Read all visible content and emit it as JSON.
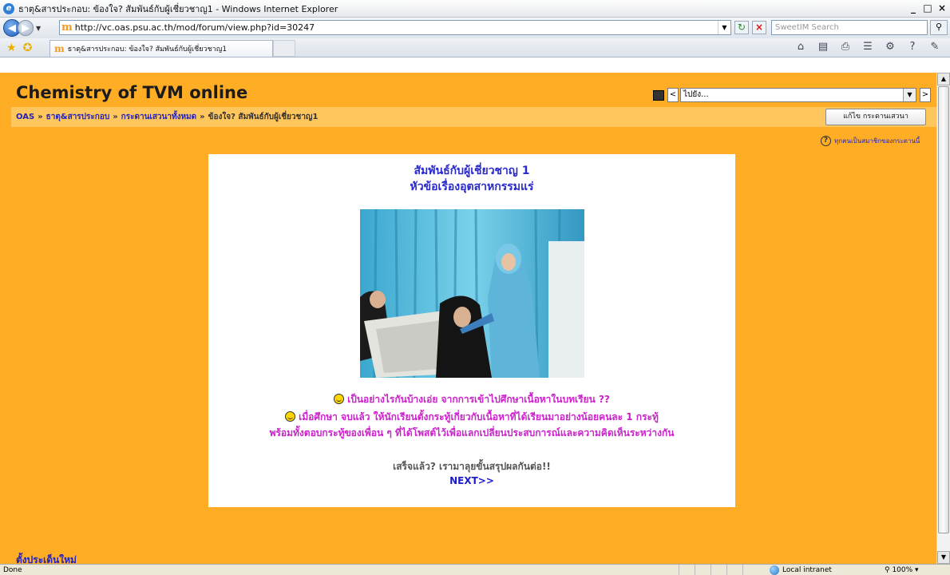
{
  "window": {
    "title": "ธาตุ&สารประกอบ: ข้องใจ? สัมพันธ์กับผู้เชี่ยวชาญ1 - Windows Internet Explorer",
    "buttons": [
      "_",
      "□",
      "×"
    ]
  },
  "address": {
    "url": "http://vc.oas.psu.ac.th/mod/forum/view.php?id=30247",
    "search_placeholder": "SweetIM Search"
  },
  "tab": {
    "label": "ธาตุ&สารประกอบ: ข้องใจ? สัมพันธ์กับผู้เชี่ยวชาญ1"
  },
  "page": {
    "site_title": "Chemistry of TVM online",
    "jump_to": "ไปยัง...",
    "breadcrumb": [
      "OAS",
      "ธาตุ&สารประกอบ",
      "กระดานเสวนาทั้งหมด"
    ],
    "breadcrumb_current": "ข้องใจ? สัมพันธ์กับผู้เชี่ยวชาญ1",
    "breadcrumb_sep": "»",
    "edit_button": "แก้ไข กระดานเสวนา",
    "subscribe_text": "ทุกคนเป็นสมาชิกของกระดานนี้",
    "new_topic": "ตั้งประเด็นใหม่"
  },
  "post": {
    "title_line1": "สัมพันธ์กับผู้เชี่ยวชาญ 1",
    "title_line2": "หัวข้อเรื่องอุตสาหกรรมแร่",
    "line1": "เป็นอย่างไรกันบ้างเอ่ย จากการเข้าไปศึกษาเนื้อหาในบทเรียน ??",
    "line2": "เมื่อศึกษา จบแล้ว ให้นักเรียนตั้งกระทู้เกี่ยวกับเนื้อหาที่ได้เรียนมาอย่างน้อยคนละ 1 กระทู้",
    "line3": "พร้อมทั้งตอบกระทู้ของเพื่อน ๆ ที่ได้โพสต์ไว้เพื่อแลกเปลี่ยนประสบการณ์และความคิดเห็นระหว่างกัน",
    "line4": "เสร็จแล้ว? เรามาลุยขั้นสรุปผลกันต่อ!!",
    "next_link": "NEXT>>"
  },
  "status": {
    "text": "Done",
    "zone": "Local intranet",
    "zoom": "100%"
  },
  "colors": {
    "page_bg": "#ffad24",
    "breadcrumb_bg": "#ffc65e",
    "link": "#2222bb",
    "post_title": "#2a2acc",
    "magenta_text": "#cc22cc"
  }
}
